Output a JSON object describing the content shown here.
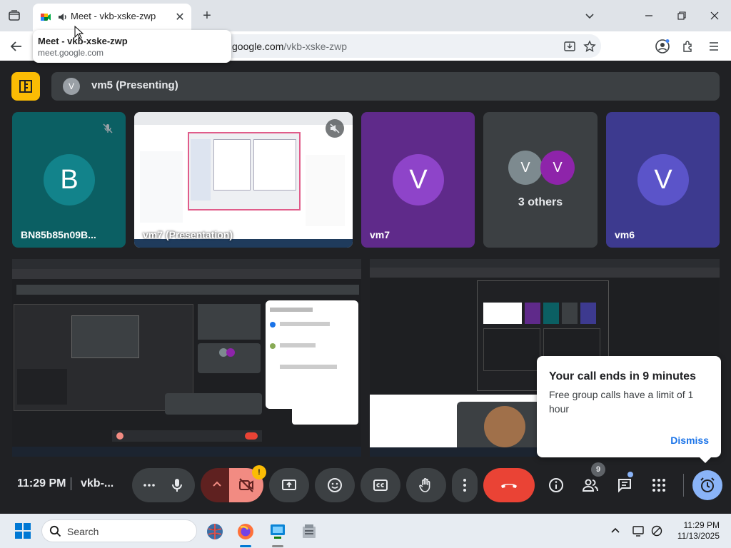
{
  "browser": {
    "tab_title": "Meet - vkb-xske-zwp",
    "tooltip_title": "Meet - vkb-xske-zwp",
    "tooltip_url": "meet.google.com",
    "url_host": "google.com",
    "url_path": "/vkb-xske-zwp"
  },
  "meet": {
    "presenter_initial": "V",
    "presenter_label": "vm5 (Presenting)",
    "tiles": [
      {
        "name": "BN85b85n09B...",
        "initial": "B",
        "avatar_color": "#12838b",
        "bg": "#0b5f63"
      },
      {
        "name": "vm7 (Presentation)"
      },
      {
        "name": "vm7",
        "initial": "V",
        "avatar_color": "#8e44c9",
        "bg": "#5f2a8a"
      },
      {
        "name": "3 others",
        "initial_a": "V",
        "initial_b": "V"
      },
      {
        "name": "vm6",
        "initial": "V",
        "avatar_color": "#5b54c9",
        "bg": "#3d3a8f"
      }
    ],
    "toast": {
      "title": "Your call ends in 9 minutes",
      "body": "Free group calls have a limit of 1 hour",
      "dismiss": "Dismiss"
    },
    "bottom": {
      "time": "11:29 PM",
      "code": "vkb-...",
      "people_count": "9",
      "camera_warning": "!"
    },
    "colors": {
      "end_call": "#ea4335",
      "camera_off": "#f28b82",
      "accent": "#8ab4f8"
    }
  },
  "taskbar": {
    "search_label": "Search",
    "clock_time": "11:29 PM",
    "clock_date": "11/13/2025"
  }
}
